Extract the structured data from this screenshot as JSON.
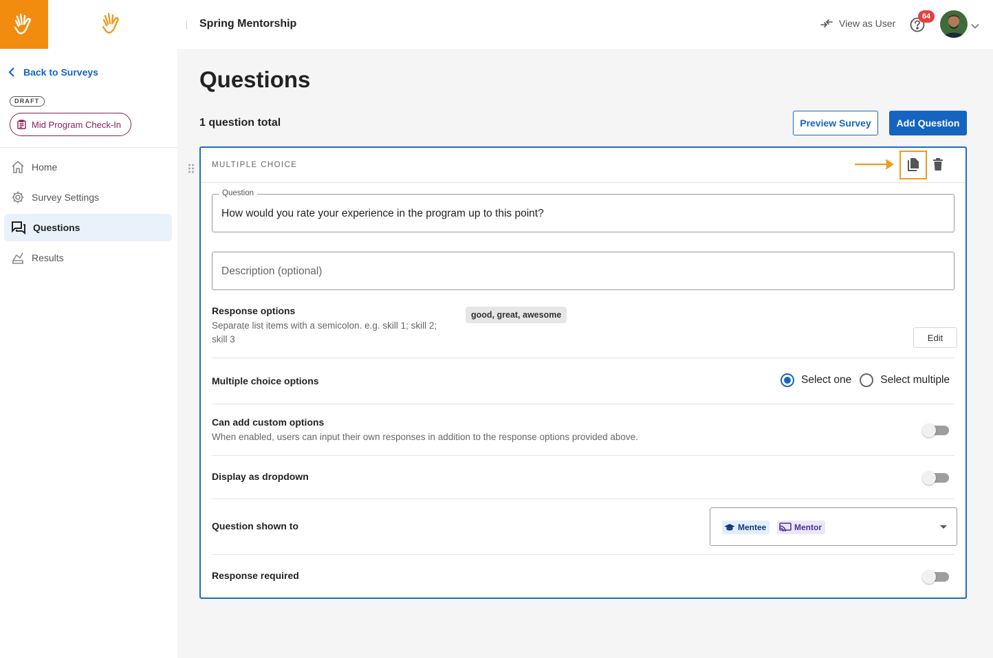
{
  "topbar": {
    "program_name": "Spring Mentorship",
    "view_as_label": "View as User",
    "notification_count": "64"
  },
  "sidebar": {
    "back_label": "Back to Surveys",
    "status_badge": "DRAFT",
    "survey_name": "Mid Program Check-In",
    "nav": [
      {
        "label": "Home",
        "icon": "home-icon"
      },
      {
        "label": "Survey Settings",
        "icon": "gear-icon"
      },
      {
        "label": "Questions",
        "icon": "questions-icon",
        "active": true
      },
      {
        "label": "Results",
        "icon": "results-icon"
      }
    ]
  },
  "main": {
    "title": "Questions",
    "total_label": "1 question total",
    "preview_button": "Preview Survey",
    "add_button": "Add Question"
  },
  "question_card": {
    "type_label": "MULTIPLE CHOICE",
    "question_legend": "Question",
    "question_value": "How would you rate your experience in the program up to this point?",
    "description_placeholder": "Description (optional)",
    "response_options_label": "Response options",
    "response_options_hint_1": "Separate list items with a semicolon. e.g. skill 1; skill 2;",
    "response_options_hint_2": "skill 3",
    "response_options_value": "good, great, awesome",
    "edit_button": "Edit",
    "mc_options_label": "Multiple choice options",
    "radio_select_one": "Select one",
    "radio_select_multiple": "Select multiple",
    "selected_mode": "Select one",
    "custom_options_label": "Can add custom options",
    "custom_options_hint": "When enabled, users can input their own responses in addition to the response options provided above.",
    "dropdown_label": "Display as dropdown",
    "shown_to_label": "Question shown to",
    "shown_to_tags": [
      "Mentee",
      "Mentor"
    ],
    "required_label": "Response required",
    "toggles": {
      "custom_options": false,
      "display_dropdown": false,
      "response_required": false
    }
  },
  "colors": {
    "brand_orange": "#f28c0f",
    "primary_blue": "#1565c0",
    "highlight_orange": "#f29a1d",
    "survey_pill": "#8a1f55",
    "badge_red": "#e4413f"
  }
}
